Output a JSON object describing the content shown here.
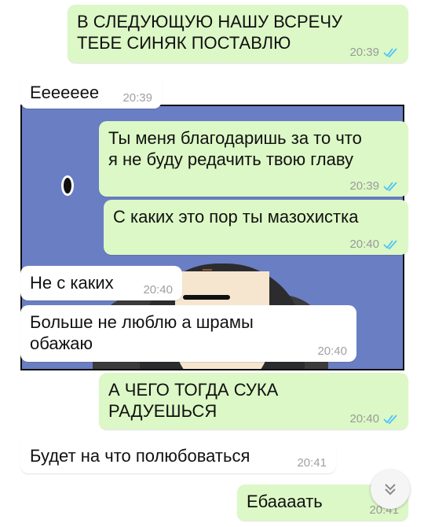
{
  "messages": [
    {
      "text": "В СЛЕДУЮЩУЮ НАШУ ВСРЕЧУ\nТЕБЕ СИНЯК ПОСТАВЛЮ",
      "time": "20:39"
    },
    {
      "text": "Ееееееe",
      "time": "20:39"
    },
    {
      "text": "Ты меня благодаришь за то что\nя не буду редачить твою главу",
      "time": "20:39"
    },
    {
      "text": "С каких это пор ты мазохистка",
      "time": "20:40"
    },
    {
      "text": "Не с каких",
      "time": "20:40"
    },
    {
      "text": "Больше не люблю а шрамы\nобажаю",
      "time": "20:40"
    },
    {
      "text": "А ЧЕГО ТОГДА СУКА\nРАДУЕШЬСЯ",
      "time": "20:40"
    },
    {
      "text": "Будет на что полюбоваться",
      "time": "20:41"
    },
    {
      "text": "Ебаааать",
      "time": "20:41"
    }
  ],
  "icons": {
    "read_receipt": "double-check-icon",
    "scroll": "chevron-double-down-icon"
  },
  "colors": {
    "outgoing_bubble": "#dcf8c6",
    "incoming_bubble": "#ffffff",
    "ticks": "#4fc3f7",
    "panel_bg": "#6a7ec4"
  }
}
